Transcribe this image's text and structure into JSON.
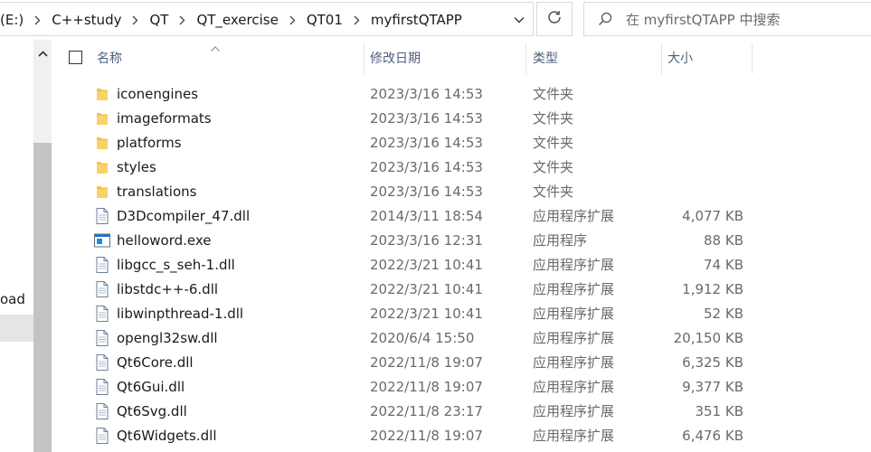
{
  "address": {
    "crumbs": [
      "(E:)",
      "C++study",
      "QT",
      "QT_exercise",
      "QT01",
      "myfirstQTAPP"
    ]
  },
  "search": {
    "placeholder": "在 myfirstQTAPP 中搜索"
  },
  "nav": {
    "partial_label": "oad"
  },
  "columns": {
    "name": "名称",
    "date": "修改日期",
    "type": "类型",
    "size": "大小"
  },
  "files": [
    {
      "icon": "folder-icon",
      "name": "iconengines",
      "date": "2023/3/16 14:53",
      "type": "文件夹",
      "size": ""
    },
    {
      "icon": "folder-icon",
      "name": "imageformats",
      "date": "2023/3/16 14:53",
      "type": "文件夹",
      "size": ""
    },
    {
      "icon": "folder-icon",
      "name": "platforms",
      "date": "2023/3/16 14:53",
      "type": "文件夹",
      "size": ""
    },
    {
      "icon": "folder-icon",
      "name": "styles",
      "date": "2023/3/16 14:53",
      "type": "文件夹",
      "size": ""
    },
    {
      "icon": "folder-icon",
      "name": "translations",
      "date": "2023/3/16 14:53",
      "type": "文件夹",
      "size": ""
    },
    {
      "icon": "dll-file-icon",
      "name": "D3Dcompiler_47.dll",
      "date": "2014/3/11 18:54",
      "type": "应用程序扩展",
      "size": "4,077 KB"
    },
    {
      "icon": "exe-file-icon",
      "name": "helloword.exe",
      "date": "2023/3/16 12:31",
      "type": "应用程序",
      "size": "88 KB"
    },
    {
      "icon": "dll-file-icon",
      "name": "libgcc_s_seh-1.dll",
      "date": "2022/3/21 10:41",
      "type": "应用程序扩展",
      "size": "74 KB"
    },
    {
      "icon": "dll-file-icon",
      "name": "libstdc++-6.dll",
      "date": "2022/3/21 10:41",
      "type": "应用程序扩展",
      "size": "1,912 KB"
    },
    {
      "icon": "dll-file-icon",
      "name": "libwinpthread-1.dll",
      "date": "2022/3/21 10:41",
      "type": "应用程序扩展",
      "size": "52 KB"
    },
    {
      "icon": "dll-file-icon",
      "name": "opengl32sw.dll",
      "date": "2020/6/4 15:50",
      "type": "应用程序扩展",
      "size": "20,150 KB"
    },
    {
      "icon": "dll-file-icon",
      "name": "Qt6Core.dll",
      "date": "2022/11/8 19:07",
      "type": "应用程序扩展",
      "size": "6,325 KB"
    },
    {
      "icon": "dll-file-icon",
      "name": "Qt6Gui.dll",
      "date": "2022/11/8 19:07",
      "type": "应用程序扩展",
      "size": "9,377 KB"
    },
    {
      "icon": "dll-file-icon",
      "name": "Qt6Svg.dll",
      "date": "2022/11/8 23:17",
      "type": "应用程序扩展",
      "size": "351 KB"
    },
    {
      "icon": "dll-file-icon",
      "name": "Qt6Widgets.dll",
      "date": "2022/11/8 19:07",
      "type": "应用程序扩展",
      "size": "6,476 KB"
    }
  ],
  "colors": {
    "folder": "#f5c242",
    "header_text": "#4c607a",
    "exe_blue": "#1e6fd0"
  }
}
